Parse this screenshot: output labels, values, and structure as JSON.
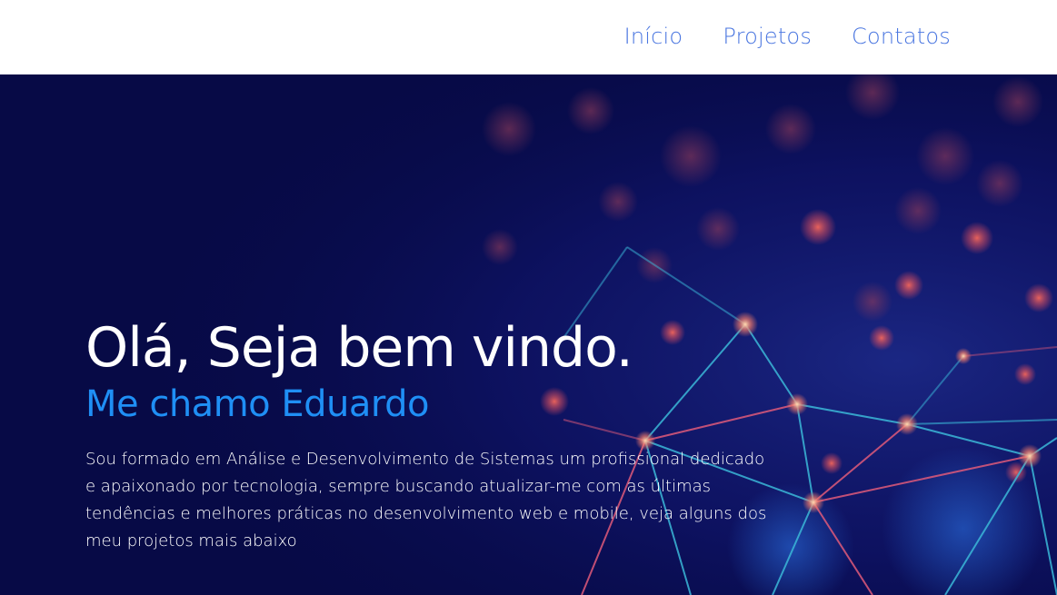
{
  "nav": {
    "items": [
      {
        "label": "Início"
      },
      {
        "label": "Projetos"
      },
      {
        "label": "Contatos"
      }
    ]
  },
  "hero": {
    "title": "Olá, Seja bem vindo.",
    "subtitle": "Me chamo Eduardo",
    "description": "Sou formado em Análise e Desenvolvimento de Sistemas um profissional dedicado e apaixonado por tecnologia, sempre buscando atualizar-me com as últimas tendências e melhores práticas no desenvolvimento web e mobile, veja alguns dos meu projetos mais abaixo"
  },
  "colors": {
    "nav_link": "#4a76e0",
    "hero_background": "#070a46",
    "hero_title": "#ffffff",
    "hero_subtitle": "#1f8ff5",
    "hero_text": "#ffffff"
  }
}
